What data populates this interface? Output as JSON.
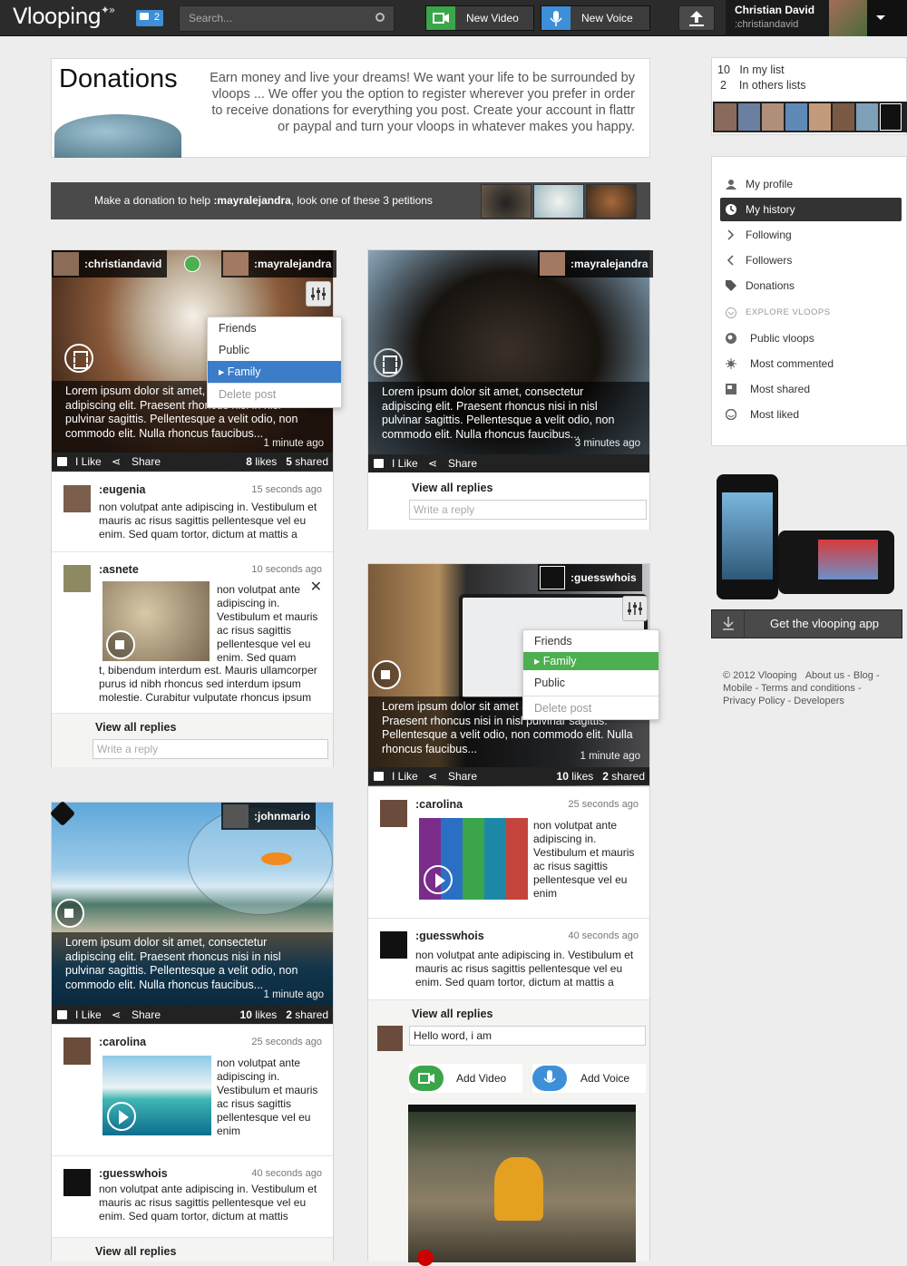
{
  "app": {
    "logo": "Vlooping",
    "notifications": "2"
  },
  "search": {
    "placeholder": "Search..."
  },
  "topbar": {
    "new_video": "New Video",
    "new_voice": "New Voice"
  },
  "user": {
    "name": "Christian David",
    "handle": ":christiandavid"
  },
  "donations": {
    "title": "Donations",
    "text": "Earn money and live your dreams! We want your life to be surrounded by vloops ... We offer you the option to register wherever you prefer in order to receive donations for everything you post. Create your account in flattr or paypal and turn your vloops in whatever makes you happy.",
    "bar_prefix": "Make a donation to help ",
    "bar_user": ":mayralejandra",
    "bar_suffix": ", look one of these 3 petitions"
  },
  "lists": {
    "in_my_list_count": "10",
    "in_my_list": "In my list",
    "in_others_count": "2",
    "in_others": "In others lists"
  },
  "menu": {
    "items": [
      "My profile",
      "My history",
      "Following",
      "Followers",
      "Donations"
    ],
    "explore_heading": "EXPLORE VLOOPS",
    "explore": [
      "Public vloops",
      "Most commented",
      "Most shared",
      "Most liked"
    ]
  },
  "get_app": "Get the vlooping app",
  "footer": {
    "copyright": "© 2012 Vlooping",
    "about": "About us",
    "blog": "Blog",
    "mobile": "Mobile",
    "terms": "Terms and conditions",
    "privacy": "Privacy Policy",
    "developers": "Developers"
  },
  "common": {
    "like": "I Like",
    "share": "Share",
    "view_all": "View all replies",
    "write_reply": "Write a reply",
    "caption": "Lorem ipsum dolor sit amet, consectetur adipiscing elit. Praesent rhoncus nisi in nisl pulvinar sagittis. Pellentesque a velit odio, non commodo elit. Nulla rhoncus faucibus...",
    "caption_cut": "Lorem ipsum dolor sit amet adipiscing elit. Praesent rhoncus nisi in nisl pulvinar sagittis. Pellentesque a velit odio, non commodo elit. Nulla rhoncus faucibus...",
    "short_text": "non volutpat ante adipiscing in. Vestibulum et mauris ac risus sagittis pellentesque vel eu enim",
    "long_text": "non volutpat ante adipiscing in. Vestibulum et mauris ac risus sagittis pellentesque vel eu enim. Sed quam tortor, dictum at mattis a",
    "long_text2": "non volutpat ante adipiscing in. Vestibulum et mauris ac risus sagittis pellentesque vel eu enim. Sed quam tortor, dictum at mattis",
    "asnete_text_side": "non volutpat ante adipiscing in. Vestibulum et mauris ac risus sagittis pellentesque vel eu enim. Sed quam",
    "asnete_text_bottom": "t, bibendum interdum est. Mauris ullamcorper purus id nibh rhoncus sed interdum ipsum molestie. Curabitur vulputate rhoncus ipsum"
  },
  "privacy_menu": {
    "friends": "Friends",
    "public": "Public",
    "family": "Family",
    "delete": "Delete post"
  },
  "post1": {
    "author": ":christiandavid",
    "recipient": ":mayralejandra",
    "time": "1 minute ago",
    "likes": "8",
    "shared": "5",
    "comments": [
      {
        "user": ":eugenia",
        "time": "15 seconds ago"
      },
      {
        "user": ":asnete",
        "time": "10 seconds ago"
      }
    ]
  },
  "post2": {
    "author": ":mayralejandra",
    "time": "3 minutes ago"
  },
  "post3": {
    "author": ":guesswhois",
    "time": "1 minute ago",
    "likes": "10",
    "shared": "2",
    "comments": [
      {
        "user": ":carolina",
        "time": "25 seconds ago"
      },
      {
        "user": ":guesswhois",
        "time": "40 seconds ago"
      }
    ],
    "reply_value": "Hello word, i am",
    "add_video": "Add Video",
    "add_voice": "Add Voice"
  },
  "post4": {
    "author": ":johnmario",
    "time": "1 minute ago",
    "likes": "10",
    "shared": "2",
    "comments": [
      {
        "user": ":carolina",
        "time": "25 seconds ago"
      },
      {
        "user": ":guesswhois",
        "time": "40 seconds ago"
      }
    ]
  },
  "labels": {
    "likes": "likes",
    "shared": "shared"
  },
  "colors": {
    "green": "#3aa54a",
    "blue": "#3d8fd8",
    "family_blue": "#3b7dc9",
    "family_green": "#4caf50"
  }
}
